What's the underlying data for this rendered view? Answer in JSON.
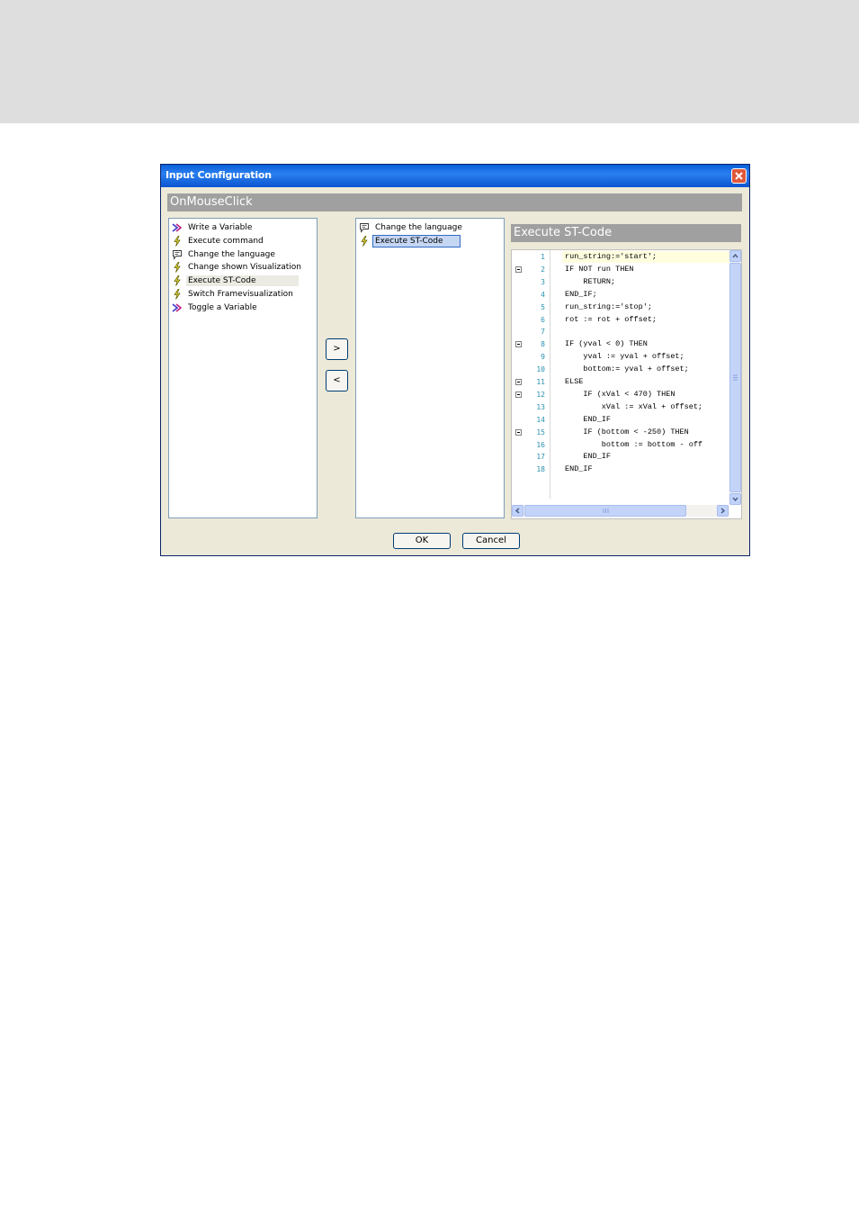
{
  "dialog": {
    "title": "Input Configuration",
    "event_header": "OnMouseClick",
    "code_header": "Execute ST-Code",
    "ok_label": "OK",
    "cancel_label": "Cancel",
    "add_label": ">",
    "remove_label": "<"
  },
  "available_actions": [
    {
      "label": "Write a Variable",
      "icon": "variable-arrow-icon"
    },
    {
      "label": "Execute command",
      "icon": "lightning-icon"
    },
    {
      "label": "Change the language",
      "icon": "speech-bubble-icon"
    },
    {
      "label": "Change shown Visualization",
      "icon": "lightning-icon"
    },
    {
      "label": "Execute ST-Code",
      "icon": "lightning-icon"
    },
    {
      "label": "Switch Framevisualization",
      "icon": "lightning-icon"
    },
    {
      "label": "Toggle a Variable",
      "icon": "variable-arrow-icon"
    }
  ],
  "configured_actions": [
    {
      "label": "Change the language",
      "icon": "speech-bubble-icon"
    },
    {
      "label": "Execute ST-Code",
      "icon": "lightning-icon"
    }
  ],
  "code_lines": [
    {
      "num": "1",
      "text": "run_string:='start';"
    },
    {
      "num": "2",
      "text": "IF NOT run THEN"
    },
    {
      "num": "3",
      "text": "    RETURN;"
    },
    {
      "num": "4",
      "text": "END_IF;"
    },
    {
      "num": "5",
      "text": "run_string:='stop';"
    },
    {
      "num": "6",
      "text": "rot := rot + offset;"
    },
    {
      "num": "7",
      "text": ""
    },
    {
      "num": "8",
      "text": "IF (yval < 0) THEN"
    },
    {
      "num": "9",
      "text": "    yval := yval + offset;"
    },
    {
      "num": "10",
      "text": "    bottom:= yval + offset;"
    },
    {
      "num": "11",
      "text": "ELSE"
    },
    {
      "num": "12",
      "text": "    IF (xVal < 470) THEN"
    },
    {
      "num": "13",
      "text": "        xVal := xVal + offset;"
    },
    {
      "num": "14",
      "text": "    END_IF"
    },
    {
      "num": "15",
      "text": "    IF (bottom < -250) THEN"
    },
    {
      "num": "16",
      "text": "        bottom := bottom - off"
    },
    {
      "num": "17",
      "text": "    END_IF"
    },
    {
      "num": "18",
      "text": "END_IF"
    }
  ]
}
